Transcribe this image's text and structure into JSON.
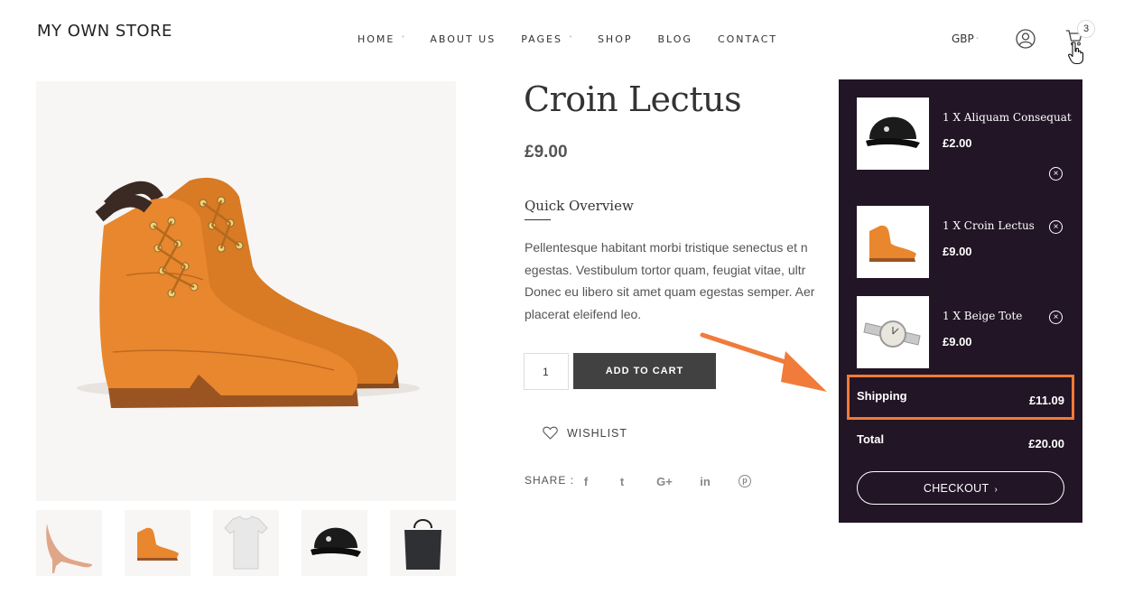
{
  "header": {
    "logo": "MY OWN STORE",
    "nav": [
      {
        "label": "HOME",
        "caret": "˅"
      },
      {
        "label": "ABOUT US",
        "caret": ""
      },
      {
        "label": "PAGES",
        "caret": "˅"
      },
      {
        "label": "SHOP",
        "caret": ""
      },
      {
        "label": "BLOG",
        "caret": ""
      },
      {
        "label": "CONTACT",
        "caret": ""
      }
    ],
    "currency": "GBP",
    "currency_caret": "˅",
    "cart_count": "3",
    "icons": {
      "account": "user-icon",
      "cart": "cart-icon",
      "pointer": "hand-cursor-icon"
    }
  },
  "gallery": {
    "main_image": "orange-boots",
    "thumbnails": [
      "nude-heels",
      "orange-boots",
      "white-tshirt",
      "black-cap",
      "black-tote"
    ]
  },
  "product": {
    "title": "Croin Lectus",
    "price": "£9.00",
    "overview_title": "Quick Overview",
    "overview_lines": [
      "Pellentesque habitant morbi tristique senectus et n",
      "egestas. Vestibulum tortor quam, feugiat vitae, ultr",
      "Donec eu libero sit amet quam egestas semper. Aer",
      "placerat eleifend leo."
    ],
    "quantity": "1",
    "add_to_cart": "ADD TO CART",
    "wishlist": "WISHLIST",
    "share_label": "SHARE :",
    "social": [
      {
        "icon": "facebook-icon",
        "glyph": "f"
      },
      {
        "icon": "twitter-icon",
        "glyph": "t"
      },
      {
        "icon": "google-plus-icon",
        "glyph": "G+"
      },
      {
        "icon": "linkedin-icon",
        "glyph": "in"
      },
      {
        "icon": "pinterest-icon",
        "glyph": "p"
      }
    ]
  },
  "mini_cart": {
    "items": [
      {
        "name": "1 X Aliquam Consequat",
        "price": "£2.00",
        "image": "black-cap"
      },
      {
        "name": "1 X Croin Lectus",
        "price": "£9.00",
        "image": "orange-boots"
      },
      {
        "name": "1 X Beige Tote",
        "price": "£9.00",
        "image": "silver-watch"
      }
    ],
    "remove_glyph": "×",
    "shipping_label": "Shipping",
    "shipping_value": "£11.09",
    "total_label": "Total",
    "total_value": "£20.00",
    "checkout": "CHECKOUT",
    "checkout_chevron": "›"
  },
  "colors": {
    "cart_panel": "#221526",
    "highlight": "#f37a35",
    "button": "#414141",
    "image_bg": "#f7f6f4"
  }
}
